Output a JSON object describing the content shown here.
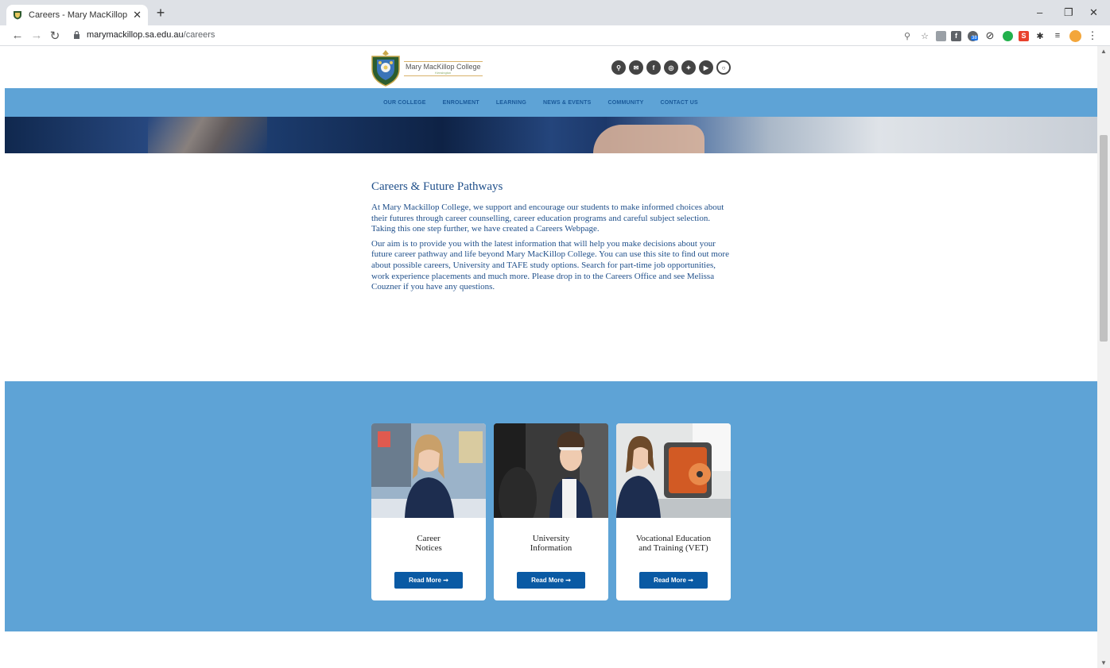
{
  "browser": {
    "tab_title": "Careers - Mary MacKillop College",
    "new_tab": "+",
    "url_host": "marymackillop.sa.edu.au",
    "url_path": "/careers",
    "window_min": "–",
    "window_restore": "❐",
    "window_close": "✕",
    "ext_badge": "38"
  },
  "site": {
    "logo_name": "Mary MacKillop College",
    "logo_sub": "Kensington",
    "nav": [
      "OUR COLLEGE",
      "ENROLMENT",
      "LEARNING",
      "NEWS & EVENTS",
      "COMMUNITY",
      "CONTACT US"
    ],
    "social_icons": [
      "search-icon",
      "email-icon",
      "facebook-icon",
      "instagram-icon",
      "twitter-icon",
      "youtube-icon",
      "chat-icon"
    ]
  },
  "intro": {
    "title": "Careers & Future Pathways",
    "para1": "At Mary Mackillop College, we support and encourage our students to make informed choices about their futures through career counselling, career education programs and careful subject selection. Taking this one step further, we have created a Careers Webpage.",
    "para2": "Our aim is to provide you with the latest information that will help you make decisions about your future career pathway and life beyond Mary MacKillop College. You can use this site to find out more about possible careers, University and TAFE study options. Search for part-time job opportunities, work experience placements and much more. Please drop in to the Careers Office and see Melissa Couzner if you have any questions."
  },
  "cards": [
    {
      "title_line1": "Career",
      "title_line2": "Notices",
      "button": "Read More ➞"
    },
    {
      "title_line1": "University",
      "title_line2": "Information",
      "button": "Read More ➞"
    },
    {
      "title_line1": "Vocational Education",
      "title_line2": "and Training (VET)",
      "button": "Read More ➞"
    }
  ],
  "colors": {
    "nav_band": "#5ea3d6",
    "link_blue": "#1f4f8a",
    "button_blue": "#0a5aa4"
  }
}
